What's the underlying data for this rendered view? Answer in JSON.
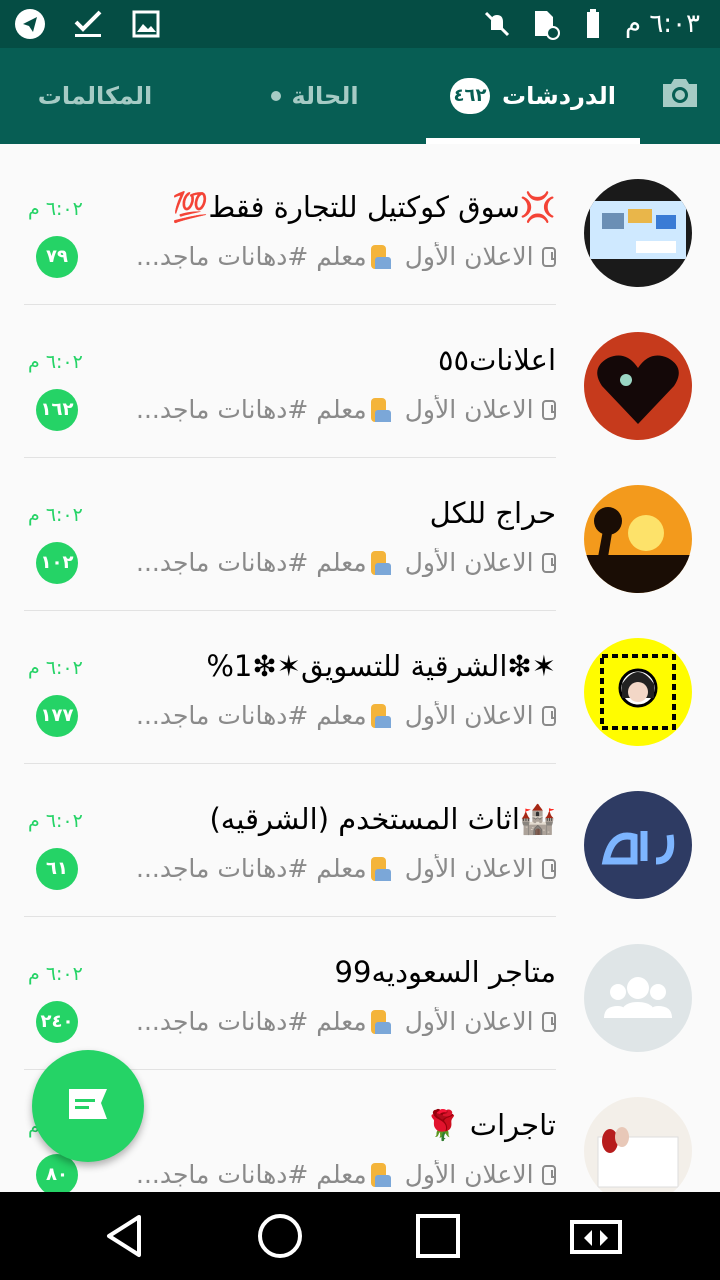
{
  "status_bar": {
    "time": "٦:٠٣ م",
    "left_icons": [
      "telegram-icon",
      "download-done-icon",
      "image-icon"
    ],
    "right_icons": [
      "mute-icon",
      "file-blocked-icon",
      "battery-icon"
    ]
  },
  "tabs": {
    "camera_icon": "camera-icon",
    "chats_label": "الدردشات",
    "chats_badge": "٤٦٢",
    "status_label": "الحالة",
    "calls_label": "المكالمات"
  },
  "chats": [
    {
      "name": "💢سوق كوكتيل للتجارة فقط💯",
      "time": "٦:٠٢ م",
      "preview_prefix": "الاعلان الأول",
      "preview_text": "معلم #دهانات ماجد...",
      "unread": "٧٩",
      "avatar": "market-avatar"
    },
    {
      "name": "اعلانات٥٥",
      "time": "٦:٠٢ م",
      "preview_prefix": "الاعلان الأول",
      "preview_text": "معلم #دهانات ماجد...",
      "unread": "١٦٢",
      "avatar": "heart-avatar"
    },
    {
      "name": "حراج للكل",
      "time": "٦:٠٢ م",
      "preview_prefix": "الاعلان الأول",
      "preview_text": "معلم #دهانات ماجد...",
      "unread": "١٠٢",
      "avatar": "sunset-avatar"
    },
    {
      "name": "✶❇الشرقية للتسويق✶❇1%",
      "time": "٦:٠٢ م",
      "preview_prefix": "الاعلان الأول",
      "preview_text": "معلم #دهانات ماجد...",
      "unread": "١٧٧",
      "avatar": "snapcode-avatar"
    },
    {
      "name": "🏰اثاث المستخدم (الشرقيه)",
      "time": "٦:٠٢ م",
      "preview_prefix": "الاعلان الأول",
      "preview_text": "معلم #دهانات ماجد...",
      "unread": "٦١",
      "avatar": "haraj-avatar"
    },
    {
      "name": "متاجر السعوديه99",
      "time": "٦:٠٢ م",
      "preview_prefix": "الاعلان الأول",
      "preview_text": "معلم #دهانات ماجد...",
      "unread": "٢٤٠",
      "avatar": "group-avatar"
    },
    {
      "name": "تاجرات 🌹",
      "time": "٦:٠٢ م",
      "preview_prefix": "الاعلان الأول",
      "preview_text": "معلم #دهانات ماجد...",
      "unread": "٨٠",
      "avatar": "nails-avatar"
    }
  ],
  "fab_icon": "new-chat-icon",
  "nav_icons": [
    "back-icon",
    "home-icon",
    "recents-icon",
    "screen-rotate-icon"
  ],
  "colors": {
    "header": "#075e54",
    "status_bar": "#054d44",
    "accent": "#25d366"
  }
}
